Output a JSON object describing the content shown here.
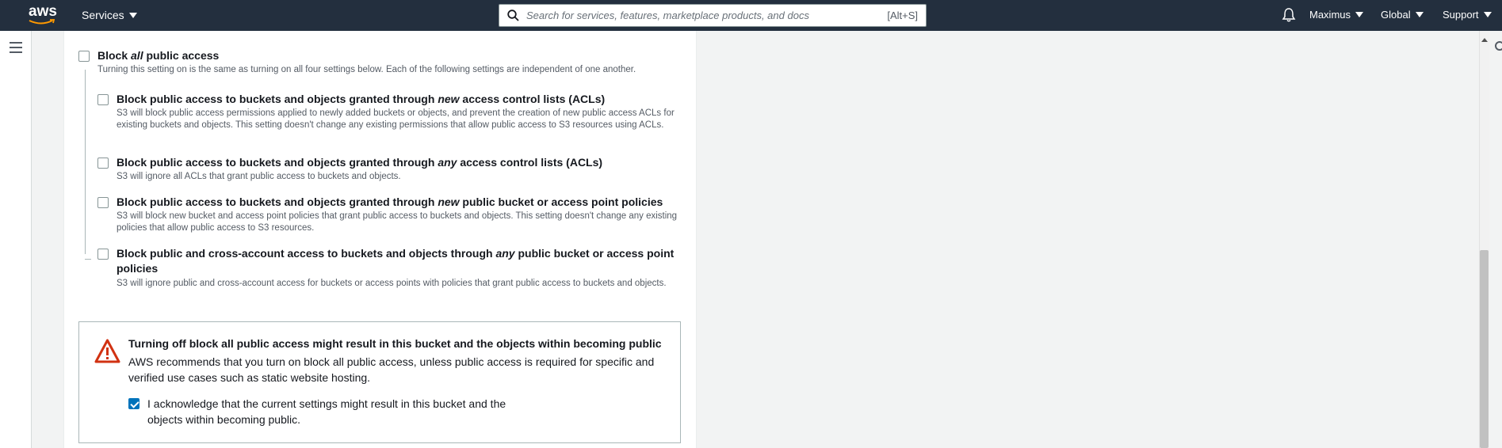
{
  "topnav": {
    "logo_text": "aws",
    "services_label": "Services",
    "search_placeholder": "Search for services, features, marketplace products, and docs",
    "search_shortcut": "[Alt+S]",
    "user_label": "Maximus",
    "region_label": "Global",
    "support_label": "Support"
  },
  "block_public_access": {
    "master": {
      "title_pre": "Block ",
      "title_em": "all",
      "title_post": " public access",
      "description": "Turning this setting on is the same as turning on all four settings below. Each of the following settings are independent of one another.",
      "checked": false
    },
    "options": [
      {
        "title_pre": "Block public access to buckets and objects granted through ",
        "title_em": "new",
        "title_post": " access control lists (ACLs)",
        "description": "S3 will block public access permissions applied to newly added buckets or objects, and prevent the creation of new public access ACLs for existing buckets and objects. This setting doesn't change any existing permissions that allow public access to S3 resources using ACLs.",
        "checked": false
      },
      {
        "title_pre": "Block public access to buckets and objects granted through ",
        "title_em": "any",
        "title_post": " access control lists (ACLs)",
        "description": "S3 will ignore all ACLs that grant public access to buckets and objects.",
        "checked": false
      },
      {
        "title_pre": "Block public access to buckets and objects granted through ",
        "title_em": "new",
        "title_post": " public bucket or access point policies",
        "description": "S3 will block new bucket and access point policies that grant public access to buckets and objects. This setting doesn't change any existing policies that allow public access to S3 resources.",
        "checked": false
      },
      {
        "title_pre": "Block public and cross-account access to buckets and objects through ",
        "title_em": "any",
        "title_post": " public bucket or access point policies",
        "description": "S3 will ignore public and cross-account access for buckets or access points with policies that grant public access to buckets and objects.",
        "checked": false
      }
    ]
  },
  "warning": {
    "title": "Turning off block all public access might result in this bucket and the objects within becoming public",
    "body": "AWS recommends that you turn on block all public access, unless public access is required for specific and verified use cases such as static website hosting.",
    "acknowledge_label": "I acknowledge that the current settings might result in this bucket and the objects within becoming public.",
    "acknowledge_checked": true
  },
  "colors": {
    "nav_bg": "#232f3e",
    "checkbox_checked": "#0073bb",
    "warning_red": "#d13212",
    "smile_orange": "#ff9900"
  },
  "icons": [
    "menu-icon",
    "search-icon",
    "bell-icon",
    "warning-icon",
    "chevron-down-icon"
  ]
}
